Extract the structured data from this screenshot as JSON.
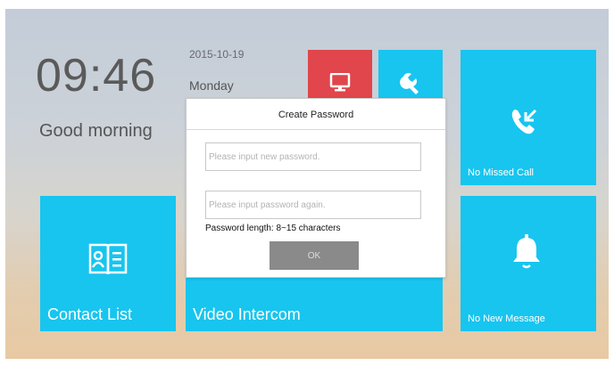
{
  "home": {
    "time": "09:46",
    "greeting": "Good morning",
    "date": "2015-10-19",
    "weekday": "Monday"
  },
  "tiles": {
    "monitor": {
      "icon": "monitor-icon",
      "color": "#e0464b"
    },
    "settings": {
      "icon": "wrench-icon",
      "color": "#17c5ef"
    },
    "missed_call": {
      "label": "No Missed Call",
      "icon": "missed-call-icon"
    },
    "contact_list": {
      "label": "Contact List",
      "icon": "contact-book-icon"
    },
    "video_intercom": {
      "label": "Video Intercom"
    },
    "message": {
      "label": "No New Message",
      "icon": "bell-icon"
    }
  },
  "dialog": {
    "title": "Create Password",
    "new_password_placeholder": "Please input new password.",
    "confirm_password_placeholder": "Please input password again.",
    "hint": "Password length: 8~15 characters",
    "ok_label": "OK"
  },
  "colors": {
    "tile_blue": "#17c5ef",
    "tile_red": "#e0464b",
    "accent_green": "#8cc63f",
    "button_gray": "#8a8a8a"
  }
}
